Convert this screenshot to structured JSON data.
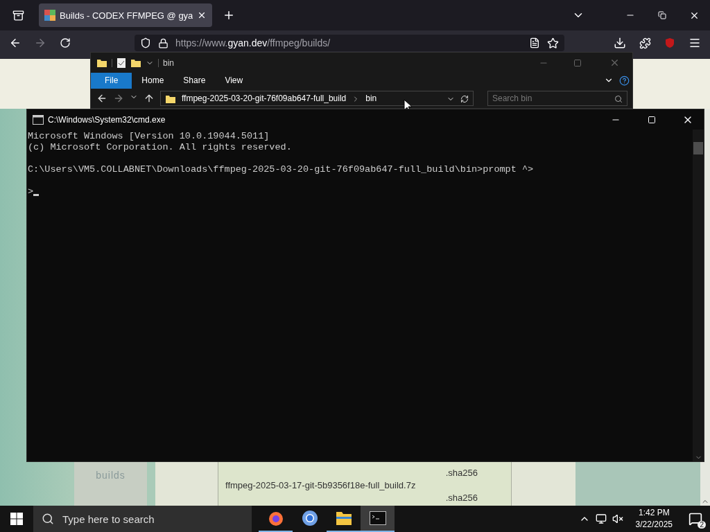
{
  "browser": {
    "tab": {
      "title": "Builds - CODEX FFMPEG @ gya",
      "selected": true
    },
    "url": {
      "prefix": "https://www.",
      "domain": "gyan.dev",
      "path": "/ffmpeg/builds/"
    }
  },
  "page": {
    "sidebar_items": [
      "builds"
    ],
    "file_lines": [
      {
        "kind": "hash",
        "text": ".sha256"
      },
      {
        "kind": "name",
        "text": "ffmpeg-2025-03-17-git-5b9356f18e-full_build.7z"
      },
      {
        "kind": "hash",
        "text": ".sha256"
      }
    ]
  },
  "explorer": {
    "title": "bin",
    "ribbon_tabs": [
      {
        "label": "File",
        "selected": true
      },
      {
        "label": "Home",
        "selected": false
      },
      {
        "label": "Share",
        "selected": false
      },
      {
        "label": "View",
        "selected": false
      }
    ],
    "path": [
      "ffmpeg-2025-03-20-git-76f09ab647-full_build",
      "bin"
    ],
    "search": {
      "placeholder": "Search bin"
    }
  },
  "cmd": {
    "title": "C:\\Windows\\System32\\cmd.exe",
    "blocks": [
      [
        "Microsoft Windows [Version 10.0.19044.5011]",
        "(c) Microsoft Corporation. All rights reserved."
      ],
      [
        "C:\\Users\\VM5.COLLABNET\\Downloads\\ffmpeg-2025-03-20-git-76f09ab647-full_build\\bin>prompt ^>"
      ],
      [
        ">"
      ]
    ]
  },
  "taskbar": {
    "search": {
      "placeholder": "Type here to search"
    },
    "apps": [
      {
        "kind": "firefox",
        "running": true,
        "selected": false
      },
      {
        "kind": "chrome",
        "running": false,
        "selected": false
      },
      {
        "kind": "explorer",
        "running": true,
        "selected": false
      },
      {
        "kind": "terminal",
        "running": true,
        "selected": true
      }
    ],
    "time": "1:42 PM",
    "date": "3/22/2025",
    "notifications": "2"
  }
}
